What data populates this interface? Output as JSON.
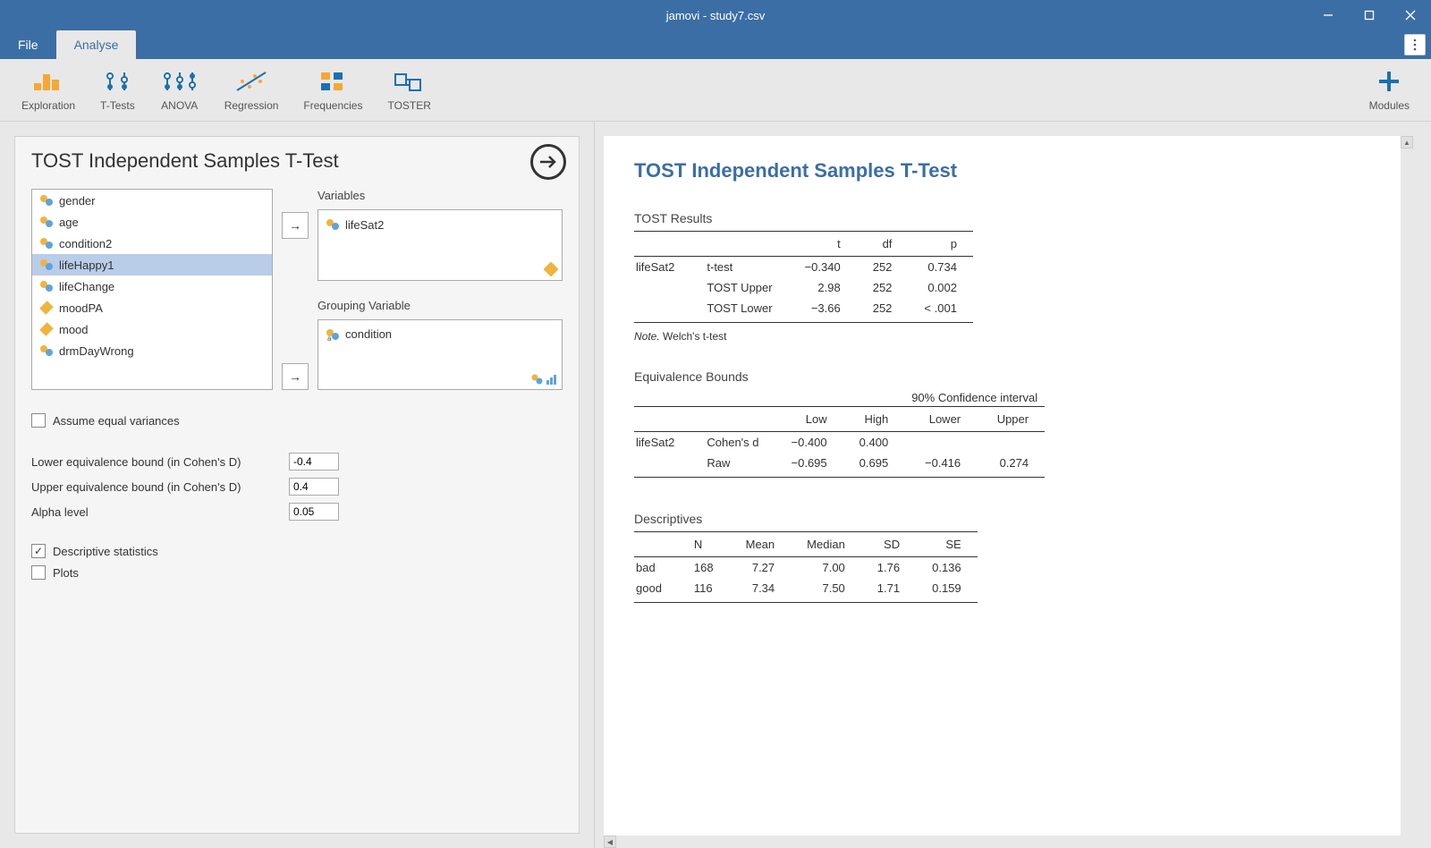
{
  "titlebar": {
    "title": "jamovi - study7.csv"
  },
  "menubar": {
    "file": "File",
    "analyse": "Analyse"
  },
  "ribbon": {
    "exploration": "Exploration",
    "ttests": "T-Tests",
    "anova": "ANOVA",
    "regression": "Regression",
    "frequencies": "Frequencies",
    "toster": "TOSTER",
    "modules": "Modules"
  },
  "options": {
    "title": "TOST Independent Samples T-Test",
    "vars_label": "Variables",
    "group_label": "Grouping Variable",
    "source_vars": [
      "gender",
      "age",
      "condition2",
      "lifeHappy1",
      "lifeChange",
      "moodPA",
      "mood",
      "drmDayWrong"
    ],
    "source_selected": "lifeHappy1",
    "source_continuous": [
      "moodPA",
      "mood"
    ],
    "selected_var": "lifeSat2",
    "grouping_var": "condition",
    "assume_equal": "Assume equal variances",
    "lower_bound_label": "Lower equivalence bound (in Cohen's D)",
    "lower_bound_value": "-0.4",
    "upper_bound_label": "Upper equivalence bound (in Cohen's D)",
    "upper_bound_value": "0.4",
    "alpha_label": "Alpha level",
    "alpha_value": "0.05",
    "descriptives": "Descriptive statistics",
    "plots": "Plots"
  },
  "results": {
    "title": "TOST Independent Samples T-Test",
    "tost_header": "TOST Results",
    "tost_cols": [
      "",
      "",
      "t",
      "df",
      "p"
    ],
    "tost_rows": [
      [
        "lifeSat2",
        "t-test",
        "−0.340",
        "252",
        "0.734"
      ],
      [
        "",
        "TOST Upper",
        "2.98",
        "252",
        "0.002"
      ],
      [
        "",
        "TOST Lower",
        "−3.66",
        "252",
        "< .001"
      ]
    ],
    "note_label": "Note.",
    "note_text": "Welch's t-test",
    "eq_header": "Equivalence Bounds",
    "eq_ci": "90% Confidence interval",
    "eq_sub": [
      "",
      "",
      "Low",
      "High",
      "Lower",
      "Upper"
    ],
    "eq_rows": [
      [
        "lifeSat2",
        "Cohen's d",
        "−0.400",
        "0.400",
        "",
        ""
      ],
      [
        "",
        "Raw",
        "−0.695",
        "0.695",
        "−0.416",
        "0.274"
      ]
    ],
    "desc_header": "Descriptives",
    "desc_cols": [
      "",
      "N",
      "Mean",
      "Median",
      "SD",
      "SE"
    ],
    "desc_rows": [
      [
        "bad",
        "168",
        "7.27",
        "7.00",
        "1.76",
        "0.136"
      ],
      [
        "good",
        "116",
        "7.34",
        "7.50",
        "1.71",
        "0.159"
      ]
    ]
  }
}
